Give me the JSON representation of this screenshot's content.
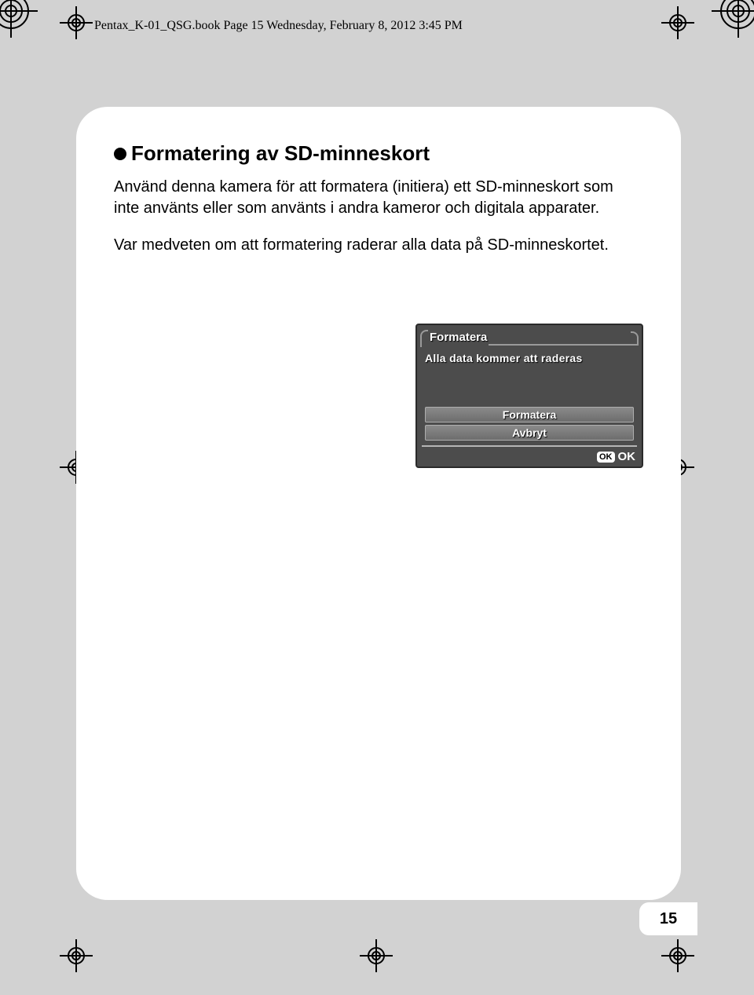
{
  "header": {
    "line": "Pentax_K-01_QSG.book  Page 15  Wednesday, February 8, 2012  3:45 PM"
  },
  "content": {
    "heading": "Formatering av SD-minneskort",
    "para1": "Använd denna kamera för att formatera (initiera) ett SD-minneskort som inte använts eller som använts i andra kameror och digitala apparater.",
    "para2": "Var medveten om att formatering raderar alla data på SD-minneskortet."
  },
  "dialog": {
    "title": "Formatera",
    "message": "Alla data kommer att raderas",
    "options": {
      "format": "Formatera",
      "cancel": "Avbryt"
    },
    "ok_badge": "OK",
    "ok_label": "OK"
  },
  "page_number": "15"
}
